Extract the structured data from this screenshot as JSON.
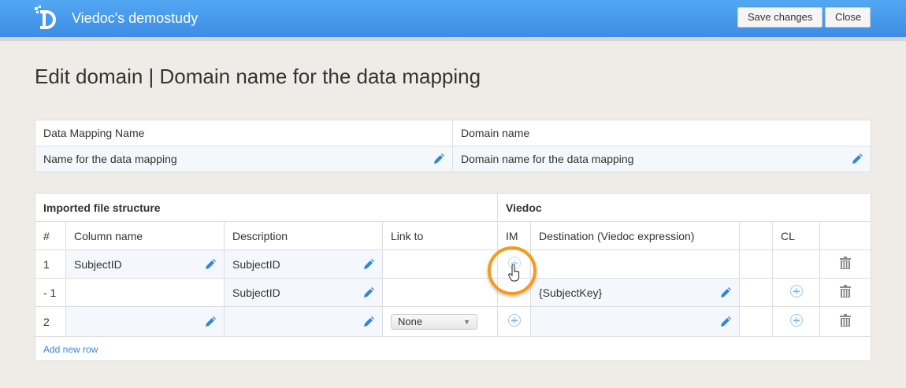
{
  "header": {
    "app_title": "Viedoc's demostudy",
    "save_label": "Save changes",
    "close_label": "Close"
  },
  "page_title": "Edit domain | Domain name for the data mapping",
  "mapping": {
    "name_label": "Data Mapping Name",
    "domain_label": "Domain name",
    "name_value": "Name for the data mapping",
    "domain_value": "Domain name for the data mapping"
  },
  "grid": {
    "section_imported": "Imported file structure",
    "section_viedoc": "Viedoc",
    "columns": {
      "num": "#",
      "column_name": "Column name",
      "description": "Description",
      "link_to": "Link to",
      "im": "IM",
      "destination": "Destination (Viedoc expression)",
      "cl": "CL"
    },
    "rows": [
      {
        "num": "1",
        "column_name": "SubjectID",
        "description": "SubjectID",
        "link_to": "",
        "destination": ""
      },
      {
        "num": "- 1",
        "column_name": "",
        "description": "SubjectID",
        "link_to": "",
        "destination": "{SubjectKey}"
      },
      {
        "num": "2",
        "column_name": "",
        "description": "",
        "link_to": "None",
        "destination": ""
      }
    ],
    "add_row": "Add new row"
  },
  "colors": {
    "accent": "#3d8de4",
    "highlight": "#f59b1c"
  }
}
